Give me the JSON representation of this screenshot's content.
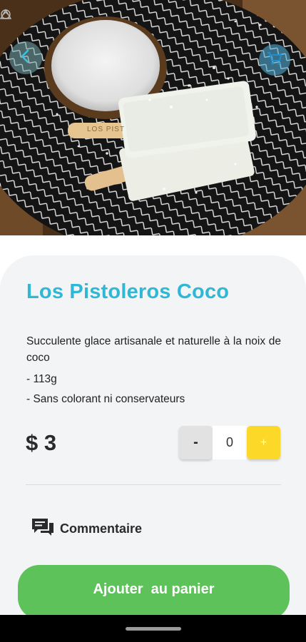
{
  "product": {
    "title": "Los Pistoleros Coco",
    "description": "Succulente glace artisanale et naturelle à la noix de coco",
    "details": [
      "- 113g",
      "- Sans colorant ni conservateurs"
    ],
    "price": "$ 3",
    "stick_brand": "LOS PIST"
  },
  "quantity": {
    "minus_label": "-",
    "value": "0",
    "plus_label": "+"
  },
  "comment": {
    "label": "Commentaire"
  },
  "cart_button": {
    "label": "Ajouter  au panier"
  },
  "colors": {
    "title": "#2fb8d6",
    "plus_button": "#fcd829",
    "add_button": "#5ec25a"
  },
  "icons": {
    "back": "chevron-left-icon",
    "cart": "cart-icon",
    "comment": "chat-bubbles-icon"
  }
}
